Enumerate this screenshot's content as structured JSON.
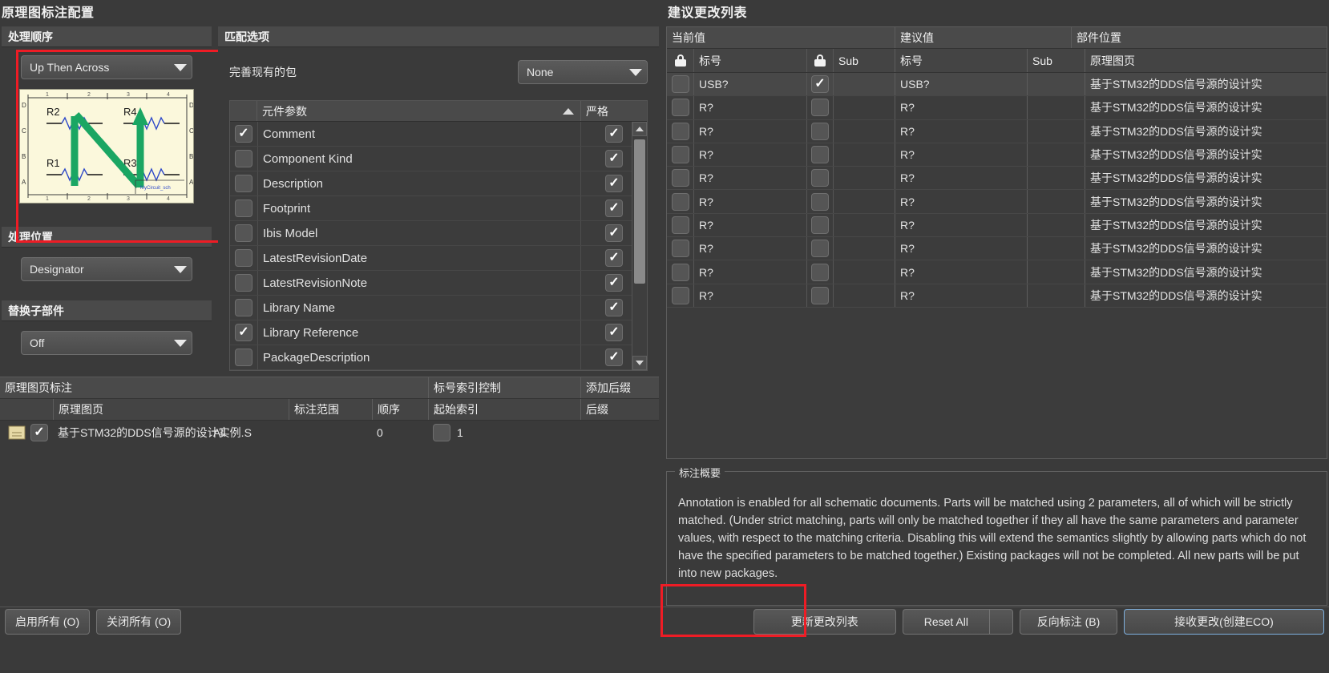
{
  "window": {
    "left_title": "原理图标注配置",
    "right_title": "建议更改列表"
  },
  "processing_order": {
    "group_label": "处理顺序",
    "selected": "Up Then Across",
    "preview": {
      "designators": [
        "R2",
        "R4",
        "R1",
        "R3"
      ],
      "sheet_label": "MyCircuit_sch",
      "column_labels": [
        "1",
        "2",
        "3",
        "4"
      ],
      "row_labels": [
        "D",
        "C",
        "B",
        "A"
      ],
      "arrow_color": "#1aa663"
    }
  },
  "processing_location": {
    "group_label": "处理位置",
    "selected": "Designator"
  },
  "sub_part": {
    "group_label": "替换子部件",
    "selected": "Off"
  },
  "matching_options": {
    "group_label": "匹配选项",
    "existing_packages_label": "完善现有的包",
    "existing_packages_value": "None",
    "table": {
      "columns": [
        "",
        "元件参数",
        "严格"
      ],
      "rows": [
        {
          "checked": true,
          "name": "Comment",
          "strict": true
        },
        {
          "checked": false,
          "name": "Component Kind",
          "strict": true
        },
        {
          "checked": false,
          "name": "Description",
          "strict": true
        },
        {
          "checked": false,
          "name": "Footprint",
          "strict": true
        },
        {
          "checked": false,
          "name": "Ibis Model",
          "strict": true
        },
        {
          "checked": false,
          "name": "LatestRevisionDate",
          "strict": true
        },
        {
          "checked": false,
          "name": "LatestRevisionNote",
          "strict": true
        },
        {
          "checked": false,
          "name": "Library Name",
          "strict": true
        },
        {
          "checked": true,
          "name": "Library Reference",
          "strict": true
        },
        {
          "checked": false,
          "name": "PackageDescription",
          "strict": true
        }
      ]
    }
  },
  "schematic_sheets": {
    "group_headers": [
      "原理图页标注",
      "标号索引控制",
      "添加后缀"
    ],
    "columns": [
      "原理图页",
      "标注范围",
      "顺序",
      "起始索引",
      "后缀"
    ],
    "rows": [
      {
        "enabled": true,
        "sheet": "基于STM32的DDS信号源的设计实例.S",
        "scope": "All",
        "order": "0",
        "start_index_checked": false,
        "start_index": "1",
        "suffix": ""
      }
    ]
  },
  "change_list": {
    "group_headers": [
      "当前值",
      "建议值",
      "部件位置"
    ],
    "sub_headers": [
      "标号",
      "Sub",
      "标号",
      "Sub",
      "原理图页"
    ],
    "rows": [
      {
        "lock1": false,
        "current": "USB?",
        "lock2": true,
        "current_sub": "",
        "proposed": "USB?",
        "proposed_sub": "",
        "sheet": "基于STM32的DDS信号源的设计实",
        "selected": true
      },
      {
        "lock1": false,
        "current": "R?",
        "lock2": false,
        "current_sub": "",
        "proposed": "R?",
        "proposed_sub": "",
        "sheet": "基于STM32的DDS信号源的设计实",
        "selected": false
      },
      {
        "lock1": false,
        "current": "R?",
        "lock2": false,
        "current_sub": "",
        "proposed": "R?",
        "proposed_sub": "",
        "sheet": "基于STM32的DDS信号源的设计实",
        "selected": false
      },
      {
        "lock1": false,
        "current": "R?",
        "lock2": false,
        "current_sub": "",
        "proposed": "R?",
        "proposed_sub": "",
        "sheet": "基于STM32的DDS信号源的设计实",
        "selected": false
      },
      {
        "lock1": false,
        "current": "R?",
        "lock2": false,
        "current_sub": "",
        "proposed": "R?",
        "proposed_sub": "",
        "sheet": "基于STM32的DDS信号源的设计实",
        "selected": false
      },
      {
        "lock1": false,
        "current": "R?",
        "lock2": false,
        "current_sub": "",
        "proposed": "R?",
        "proposed_sub": "",
        "sheet": "基于STM32的DDS信号源的设计实",
        "selected": false
      },
      {
        "lock1": false,
        "current": "R?",
        "lock2": false,
        "current_sub": "",
        "proposed": "R?",
        "proposed_sub": "",
        "sheet": "基于STM32的DDS信号源的设计实",
        "selected": false
      },
      {
        "lock1": false,
        "current": "R?",
        "lock2": false,
        "current_sub": "",
        "proposed": "R?",
        "proposed_sub": "",
        "sheet": "基于STM32的DDS信号源的设计实",
        "selected": false
      },
      {
        "lock1": false,
        "current": "R?",
        "lock2": false,
        "current_sub": "",
        "proposed": "R?",
        "proposed_sub": "",
        "sheet": "基于STM32的DDS信号源的设计实",
        "selected": false
      },
      {
        "lock1": false,
        "current": "R?",
        "lock2": false,
        "current_sub": "",
        "proposed": "R?",
        "proposed_sub": "",
        "sheet": "基于STM32的DDS信号源的设计实",
        "selected": false
      }
    ]
  },
  "summary": {
    "legend": "标注概要",
    "text": "Annotation is enabled for all schematic documents. Parts will be matched using 2 parameters, all of which will be strictly matched. (Under strict matching, parts will only be matched together if they all have the same parameters and parameter values, with respect to the matching criteria. Disabling this will extend the semantics slightly by allowing parts which do not have the specified parameters to be matched together.) Existing packages will not be completed. All new parts will be put into new packages."
  },
  "footer": {
    "enable_all": "启用所有 (O)",
    "disable_all": "关闭所有 (O)",
    "update_change_list": "更新更改列表",
    "reset_all": "Reset All",
    "back_annotate": "反向标注 (B)",
    "accept_changes": "接收更改(创建ECO)"
  },
  "colors": {
    "highlight": "#ee1c25",
    "accent": "#7fb2e0"
  }
}
